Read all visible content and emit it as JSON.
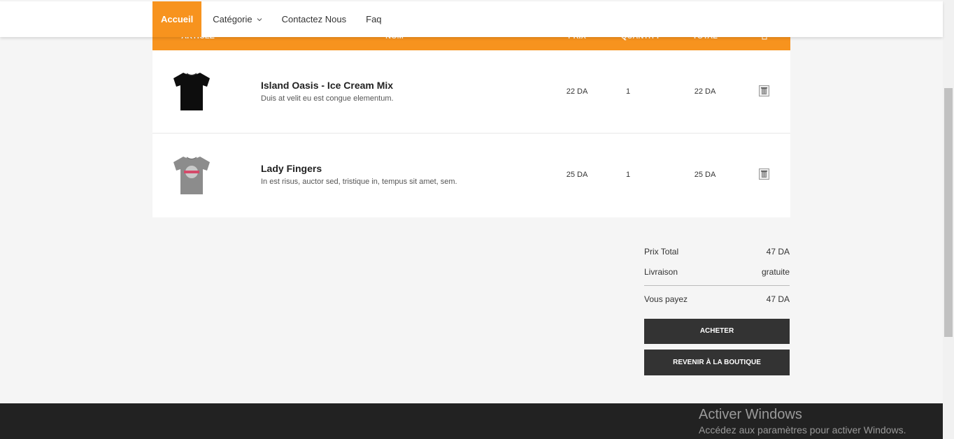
{
  "nav": {
    "items": [
      {
        "label": "Accueil",
        "active": true
      },
      {
        "label": "Catégorie",
        "has_dropdown": true
      },
      {
        "label": "Contactez Nous"
      },
      {
        "label": "Faq"
      }
    ]
  },
  "table": {
    "headers": [
      "Article",
      "Nom",
      "Prix",
      "Quantity",
      "Total"
    ],
    "header_icon": "trash-icon",
    "rows": [
      {
        "image": "black-tshirt",
        "name": "Island Oasis - Ice Cream Mix",
        "description": "Duis at velit eu est congue elementum.",
        "price": "22 DA",
        "quantity": "1",
        "total": "22 DA"
      },
      {
        "image": "grey-tshirt",
        "name": "Lady Fingers",
        "description": "In est risus, auctor sed, tristique in, tempus sit amet, sem.",
        "price": "25 DA",
        "quantity": "1",
        "total": "25 DA"
      }
    ]
  },
  "summary": {
    "total_label": "Prix Total",
    "total_value": "47 DA",
    "shipping_label": "Livraison",
    "shipping_value": "gratuite",
    "pay_label": "Vous payez",
    "pay_value": "47 DA"
  },
  "buttons": {
    "buy": "ACHETER",
    "back": "REVENIR À LA BOUTIQUE"
  },
  "watermark": {
    "title": "Activer Windows",
    "subtitle": "Accédez aux paramètres pour activer Windows."
  },
  "colors": {
    "accent": "#f7931e",
    "dark": "#333333",
    "footer": "#222222"
  }
}
